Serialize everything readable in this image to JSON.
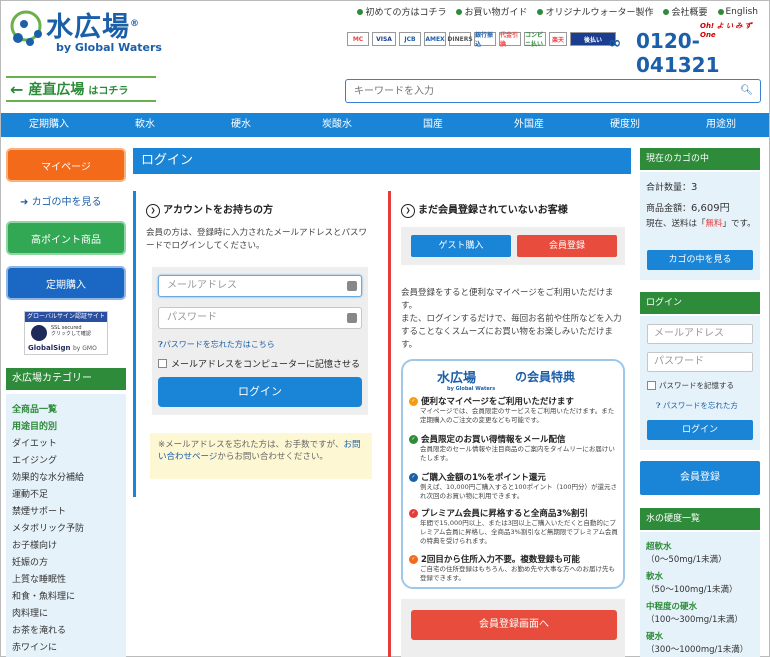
{
  "header": {
    "logo_main": "水広場",
    "logo_reg": "®",
    "logo_sub": "by Global Waters",
    "top_links": [
      "初めての方はコチラ",
      "お買い物ガイド",
      "オリジナルウォーター製作",
      "会社概要",
      "English"
    ],
    "payment_cards": [
      "MC",
      "VISA",
      "JCB",
      "AMEX",
      "DINERS",
      "銀行振込",
      "代金引換",
      "コンビニ払い",
      "楽天",
      "後払い"
    ],
    "phone_tagline": "Oh! よ い み ず One",
    "phone_number": "0120-041321",
    "phone_icon": "free-dial-icon"
  },
  "banner": {
    "arrow": "←",
    "title": "産直広場",
    "suffix": "はコチラ"
  },
  "search": {
    "placeholder": "キーワードを入力",
    "icon": "search-icon"
  },
  "nav": [
    "定期購入",
    "軟水",
    "硬水",
    "炭酸水",
    "国産",
    "外国産",
    "硬度別",
    "用途別"
  ],
  "left": {
    "mypage_label": "マイページ",
    "cart_link_label": "カゴの中を見る",
    "highpoint_label": "高ポイント商品",
    "teiki_label": "定期購入",
    "badge_top": "グローバルサイン認証サイト",
    "badge_ssl1": "SSL secured",
    "badge_ssl2": "クリックして確認",
    "badge_name": "GlobalSign",
    "badge_by": "by GMO",
    "category_head": "水広場カテゴリー",
    "categories": [
      "全商品一覧",
      "用途目的別",
      "ダイエット",
      "エイジング",
      "効果的な水分補給",
      "運動不足",
      "禁煙サポート",
      "メタボリック予防",
      "お子様向け",
      "妊娠の方",
      "上質な睡眠性",
      "和食・魚料理に",
      "肉料理に",
      "お茶を淹れる",
      "赤ワインに"
    ]
  },
  "login": {
    "title": "ログイン",
    "account_head": "アカウントをお持ちの方",
    "account_desc": "会員の方は、登録時に入力されたメールアドレスとパスワードでログインしてください。",
    "email_placeholder": "メールアドレス",
    "password_placeholder": "パスワード",
    "forgot_label": "パスワードを忘れた方はこちら",
    "remember_label": "メールアドレスをコンピューターに記憶させる",
    "login_button": "ログイン",
    "note_text": "※メールアドレスを忘れた方は、お手数ですが、",
    "note_link": "お問い合わせページ",
    "note_end": "からお問い合わせください。"
  },
  "register": {
    "head": "まだ会員登録されていないお客様",
    "guest_button": "ゲスト購入",
    "register_button": "会員登録",
    "desc1": "会員登録をすると便利なマイページをご利用いただけます。",
    "desc2": "また、ログインするだけで、毎回お名前や住所などを入力することなくスムーズにお買い物をお楽しみいただけます。",
    "benefit_logo": "水広場",
    "benefit_logo_sub": "by Global Waters",
    "benefit_title": "の会員特典",
    "benefits": [
      {
        "head": "便利なマイページをご利用いただけます",
        "text": "マイページでは、会員限定のサービスをご利用いただけます。また定期購入のご注文の変更なども可能です。",
        "color": "#f39c12"
      },
      {
        "head": "会員限定のお買い得情報をメール配信",
        "text": "会員限定のセール情報や注目商品のご案内をタイムリーにお届けいたします。",
        "color": "#2e8b3a"
      },
      {
        "head": "ご購入金額の1%をポイント還元",
        "text": "例えば、10,000円ご購入すると100ポイント（100円分）が還元され次回のお買い物に利用できます。",
        "color": "#1b5fa8"
      },
      {
        "head": "プレミアム会員に昇格すると全商品3%割引",
        "text": "年間で15,000円以上、または3回以上ご購入いただくと自動的にプレミアム会員に昇格し、全商品3%割引など無期限でプレミアム会員の特典を受けられます。",
        "color": "#e53b3b"
      },
      {
        "head": "2回目から住所入力不要。複数登録も可能",
        "text": "ご自宅の住所登録はもちろん、お勤め先や大事な方へのお届け先も登録できます。",
        "color": "#f36a1b"
      }
    ],
    "register_page_button": "会員登録画面へ"
  },
  "cart": {
    "head": "現在のカゴの中",
    "count_label": "合計数量：",
    "count_value": "3",
    "amount_label": "商品金額：",
    "amount_value": "6,609円",
    "ship_pre": "現在、送料は「",
    "ship_value": "無料",
    "ship_post": "」です。",
    "button": "カゴの中を見る"
  },
  "right_login": {
    "head": "ログイン",
    "email_placeholder": "メールアドレス",
    "password_placeholder": "パスワード",
    "remember_label": "パスワードを記憶する",
    "forgot_label": "パスワードを忘れた方",
    "button": "ログイン"
  },
  "right_register": "会員登録",
  "hardness": {
    "head": "水の硬度一覧",
    "items": [
      {
        "name": "超軟水",
        "range": "（0〜50mg/1未満）"
      },
      {
        "name": "軟水",
        "range": "（50〜100mg/1未満）"
      },
      {
        "name": "中程度の硬水",
        "range": "（100〜300mg/1未満）"
      },
      {
        "name": "硬水",
        "range": "（300〜1000mg/1未満）"
      }
    ]
  },
  "colors": {
    "brand_blue": "#1a84d6",
    "brand_green": "#2e8b3a",
    "accent_orange": "#f36a1b",
    "accent_red": "#e74c3c"
  }
}
